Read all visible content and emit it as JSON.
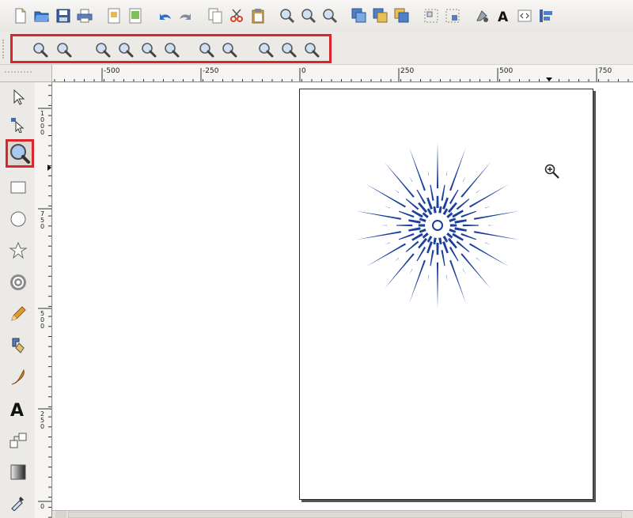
{
  "toolbar": {
    "icons": [
      "new-document-icon",
      "open-icon",
      "save-icon",
      "print-icon",
      "import-icon",
      "export-icon",
      "undo-icon",
      "redo-icon",
      "copy-icon",
      "cut-icon",
      "paste-icon",
      "zoom-selection-icon",
      "zoom-drawing-icon",
      "zoom-page-icon",
      "duplicate-icon",
      "clone-icon",
      "unlink-clone-icon",
      "group-icon",
      "ungroup-icon",
      "fill-stroke-icon",
      "text-font-icon",
      "xml-editor-icon",
      "align-icon"
    ]
  },
  "zoombar": {
    "icons": [
      "zoom-in-icon",
      "zoom-out-icon",
      "zoom-1-1-icon",
      "zoom-1-2-icon",
      "zoom-2-1-icon",
      "zoom-selection-icon",
      "zoom-drawing-icon",
      "zoom-page-icon",
      "zoom-page-width-icon",
      "zoom-previous-icon",
      "zoom-next-icon"
    ]
  },
  "rulers": {
    "horizontal_labels": [
      "-500",
      "-250",
      "0",
      "250",
      "500",
      "750"
    ],
    "vertical_labels": [
      "1\n0\n0\n0",
      "7\n5\n0",
      "5\n0\n0",
      "2\n5\n0",
      "0"
    ]
  },
  "tools": [
    "selector-tool",
    "node-tool",
    "zoom-tool",
    "rectangle-tool",
    "ellipse-tool",
    "star-tool",
    "spiral-tool",
    "pencil-tool",
    "pen-tool",
    "calligraphy-tool",
    "text-tool",
    "connector-tool",
    "gradient-tool",
    "dropper-tool"
  ],
  "colors": {
    "accent_highlight": "#d9262d",
    "star_fill": "#1a3f9c",
    "page_border": "#2b2b2b"
  }
}
